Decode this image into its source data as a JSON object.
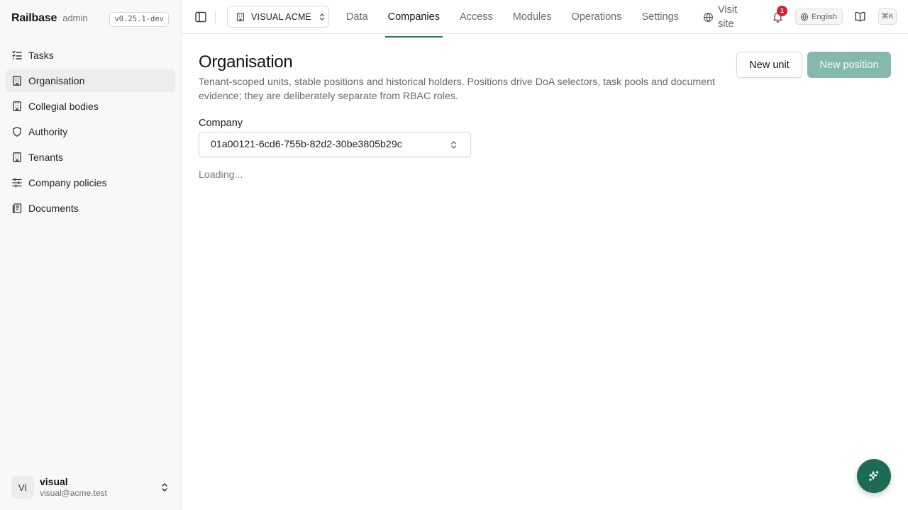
{
  "app": {
    "name": "Railbase",
    "role": "admin",
    "version": "v0.25.1-dev"
  },
  "sidebar": {
    "items": [
      {
        "label": "Tasks",
        "icon": "list-checks-icon"
      },
      {
        "label": "Organisation",
        "icon": "building-icon",
        "active": true
      },
      {
        "label": "Collegial bodies",
        "icon": "building-icon"
      },
      {
        "label": "Authority",
        "icon": "shield-icon"
      },
      {
        "label": "Tenants",
        "icon": "building-icon"
      },
      {
        "label": "Company policies",
        "icon": "sliders-icon"
      },
      {
        "label": "Documents",
        "icon": "documents-icon"
      }
    ]
  },
  "user": {
    "initials": "VI",
    "name": "visual",
    "email": "visual@acme.test"
  },
  "topbar": {
    "company": "VISUAL ACME",
    "tabs": [
      {
        "label": "Data"
      },
      {
        "label": "Companies",
        "active": true
      },
      {
        "label": "Access"
      },
      {
        "label": "Modules"
      },
      {
        "label": "Operations"
      },
      {
        "label": "Settings"
      }
    ],
    "visit_site": "Visit site",
    "notifications_count": "1",
    "language": "English",
    "shortcut": "⌘K"
  },
  "page": {
    "title": "Organisation",
    "description": "Tenant-scoped units, stable positions and historical holders. Positions drive DoA selectors, task pools and document evidence; they are deliberately separate from RBAC roles.",
    "new_unit_label": "New unit",
    "new_position_label": "New position",
    "company_label": "Company",
    "company_value": "01a00121-6cd6-755b-82d2-30be3805b29c",
    "loading_text": "Loading..."
  },
  "colors": {
    "accent": "#2d7563",
    "fab": "#1d6b57",
    "disabled_primary": "#86b9ad",
    "badge": "#d71e2a"
  }
}
